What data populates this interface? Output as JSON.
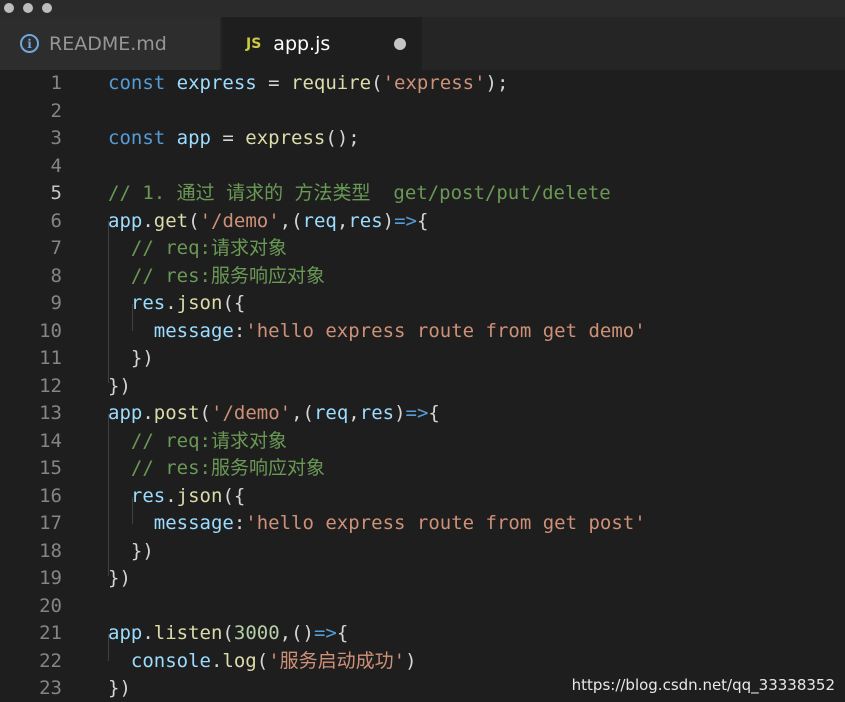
{
  "tabs": [
    {
      "label": "README.md",
      "icon": "info-icon"
    },
    {
      "label": "app.js",
      "icon": "js-file-icon",
      "badge": "JS",
      "modified": true
    }
  ],
  "editor": {
    "active_line": 5,
    "lines": [
      {
        "num": "1",
        "tokens": [
          [
            "k",
            "const "
          ],
          [
            "v",
            "express"
          ],
          [
            "p",
            " = "
          ],
          [
            "f",
            "require"
          ],
          [
            "p",
            "("
          ],
          [
            "s",
            "'express'"
          ],
          [
            "p",
            ");"
          ]
        ]
      },
      {
        "num": "2",
        "tokens": []
      },
      {
        "num": "3",
        "tokens": [
          [
            "k",
            "const "
          ],
          [
            "v",
            "app"
          ],
          [
            "p",
            " = "
          ],
          [
            "f",
            "express"
          ],
          [
            "p",
            "();"
          ]
        ]
      },
      {
        "num": "4",
        "tokens": []
      },
      {
        "num": "5",
        "tokens": [
          [
            "c",
            "// 1. 通过 请求的 方法类型  get/post/put/delete"
          ]
        ]
      },
      {
        "num": "6",
        "tokens": [
          [
            "v",
            "app"
          ],
          [
            "p",
            "."
          ],
          [
            "f",
            "get"
          ],
          [
            "p",
            "("
          ],
          [
            "s",
            "'/demo'"
          ],
          [
            "p",
            ",("
          ],
          [
            "v",
            "req"
          ],
          [
            "p",
            ","
          ],
          [
            "v",
            "res"
          ],
          [
            "p",
            ")"
          ],
          [
            "k",
            "=>"
          ],
          [
            "p",
            "{"
          ]
        ]
      },
      {
        "num": "7",
        "tokens": [
          [
            "p",
            "  "
          ],
          [
            "c",
            "// req:请求对象"
          ]
        ]
      },
      {
        "num": "8",
        "tokens": [
          [
            "p",
            "  "
          ],
          [
            "c",
            "// res:服务响应对象"
          ]
        ]
      },
      {
        "num": "9",
        "tokens": [
          [
            "p",
            "  "
          ],
          [
            "v",
            "res"
          ],
          [
            "p",
            "."
          ],
          [
            "f",
            "json"
          ],
          [
            "p",
            "({"
          ]
        ]
      },
      {
        "num": "10",
        "tokens": [
          [
            "p",
            "    "
          ],
          [
            "v",
            "message"
          ],
          [
            "p",
            ":"
          ],
          [
            "s",
            "'hello express route from get demo'"
          ]
        ]
      },
      {
        "num": "11",
        "tokens": [
          [
            "p",
            "  })"
          ]
        ]
      },
      {
        "num": "12",
        "tokens": [
          [
            "p",
            "})"
          ]
        ]
      },
      {
        "num": "13",
        "tokens": [
          [
            "v",
            "app"
          ],
          [
            "p",
            "."
          ],
          [
            "f",
            "post"
          ],
          [
            "p",
            "("
          ],
          [
            "s",
            "'/demo'"
          ],
          [
            "p",
            ",("
          ],
          [
            "v",
            "req"
          ],
          [
            "p",
            ","
          ],
          [
            "v",
            "res"
          ],
          [
            "p",
            ")"
          ],
          [
            "k",
            "=>"
          ],
          [
            "p",
            "{"
          ]
        ]
      },
      {
        "num": "14",
        "tokens": [
          [
            "p",
            "  "
          ],
          [
            "c",
            "// req:请求对象"
          ]
        ]
      },
      {
        "num": "15",
        "tokens": [
          [
            "p",
            "  "
          ],
          [
            "c",
            "// res:服务响应对象"
          ]
        ]
      },
      {
        "num": "16",
        "tokens": [
          [
            "p",
            "  "
          ],
          [
            "v",
            "res"
          ],
          [
            "p",
            "."
          ],
          [
            "f",
            "json"
          ],
          [
            "p",
            "({"
          ]
        ]
      },
      {
        "num": "17",
        "tokens": [
          [
            "p",
            "    "
          ],
          [
            "v",
            "message"
          ],
          [
            "p",
            ":"
          ],
          [
            "s",
            "'hello express route from get post'"
          ]
        ]
      },
      {
        "num": "18",
        "tokens": [
          [
            "p",
            "  })"
          ]
        ]
      },
      {
        "num": "19",
        "tokens": [
          [
            "p",
            "})"
          ]
        ]
      },
      {
        "num": "20",
        "tokens": []
      },
      {
        "num": "21",
        "tokens": [
          [
            "v",
            "app"
          ],
          [
            "p",
            "."
          ],
          [
            "f",
            "listen"
          ],
          [
            "p",
            "("
          ],
          [
            "n",
            "3000"
          ],
          [
            "p",
            ",()"
          ],
          [
            "k",
            "=>"
          ],
          [
            "p",
            "{"
          ]
        ]
      },
      {
        "num": "22",
        "tokens": [
          [
            "p",
            "  "
          ],
          [
            "v",
            "console"
          ],
          [
            "p",
            "."
          ],
          [
            "f",
            "log"
          ],
          [
            "p",
            "("
          ],
          [
            "s",
            "'服务启动成功'"
          ],
          [
            "p",
            ")"
          ]
        ]
      },
      {
        "num": "23",
        "tokens": [
          [
            "p",
            "})"
          ]
        ]
      }
    ]
  },
  "watermark": "https://blog.csdn.net/qq_33338352"
}
